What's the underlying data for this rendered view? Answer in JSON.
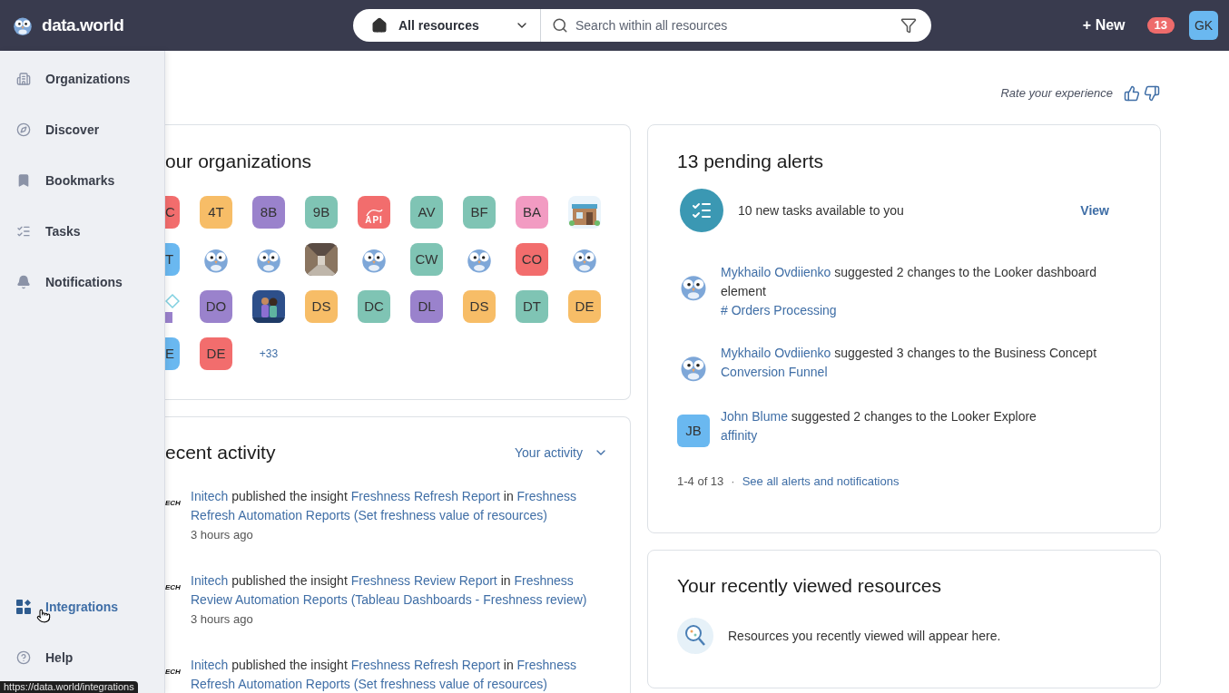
{
  "header": {
    "brand": "data.world",
    "scope": "All resources",
    "search_placeholder": "Search within all resources",
    "new_label": "+ New",
    "notification_count": "13",
    "avatar_initials": "GK"
  },
  "sidebar": {
    "items": [
      {
        "label": "Organizations",
        "hovered": false
      },
      {
        "label": "Discover",
        "hovered": false
      },
      {
        "label": "Bookmarks",
        "hovered": false
      },
      {
        "label": "Tasks",
        "hovered": false
      },
      {
        "label": "Notifications",
        "hovered": false
      }
    ],
    "bottom_items": [
      {
        "label": "Integrations",
        "hovered": true
      },
      {
        "label": "Help",
        "hovered": false
      }
    ]
  },
  "status_url": "https://data.world/integrations",
  "feedback": {
    "label": "Rate your experience"
  },
  "organizations": {
    "title": "our organizations",
    "tiles": [
      {
        "kind": "partial",
        "text": "C",
        "color": "#f26d6d"
      },
      {
        "kind": "initials",
        "text": "4T",
        "color": "#f7bd67"
      },
      {
        "kind": "initials",
        "text": "8B",
        "color": "#9a82cc"
      },
      {
        "kind": "initials",
        "text": "9B",
        "color": "#7fc4b4"
      },
      {
        "kind": "api",
        "text": "API",
        "color": "#f26d6d"
      },
      {
        "kind": "initials",
        "text": "AV",
        "color": "#7fc4b4"
      },
      {
        "kind": "initials",
        "text": "BF",
        "color": "#7fc4b4"
      },
      {
        "kind": "initials",
        "text": "BA",
        "color": "#f29bc2"
      },
      {
        "kind": "picture"
      },
      {
        "kind": "partial",
        "text": "T",
        "color": "#6ab8f0"
      },
      {
        "kind": "owl"
      },
      {
        "kind": "owl"
      },
      {
        "kind": "picture"
      },
      {
        "kind": "owl"
      },
      {
        "kind": "initials",
        "text": "CW",
        "color": "#7fc4b4"
      },
      {
        "kind": "owl"
      },
      {
        "kind": "initials",
        "text": "CO",
        "color": "#f26d6d"
      },
      {
        "kind": "owl"
      },
      {
        "kind": "shapes"
      },
      {
        "kind": "initials",
        "text": "DO",
        "color": "#9a82cc"
      },
      {
        "kind": "picture"
      },
      {
        "kind": "initials",
        "text": "DS",
        "color": "#f7bd67"
      },
      {
        "kind": "initials",
        "text": "DC",
        "color": "#7fc4b4"
      },
      {
        "kind": "initials",
        "text": "DL",
        "color": "#9a82cc"
      },
      {
        "kind": "initials",
        "text": "DS",
        "color": "#f7bd67"
      },
      {
        "kind": "initials",
        "text": "DT",
        "color": "#7fc4b4"
      },
      {
        "kind": "initials",
        "text": "DE",
        "color": "#f7bd67"
      },
      {
        "kind": "partial",
        "text": "E",
        "color": "#6ab8f0"
      },
      {
        "kind": "initials",
        "text": "DE",
        "color": "#f26d6d"
      },
      {
        "kind": "more",
        "text": "+33"
      }
    ]
  },
  "activity": {
    "title": "ecent activity",
    "filter": "Your activity",
    "items": [
      {
        "avatar_text": "ECH",
        "parts": [
          {
            "text": "Initech",
            "link": true
          },
          {
            "text": " published the insight ",
            "link": false
          },
          {
            "text": "Freshness Refresh Report",
            "link": true
          },
          {
            "text": " in ",
            "link": false
          },
          {
            "text": "Freshness",
            "link": true
          },
          {
            "text": "Refresh Automation Reports (Set freshness value of resources)",
            "link": true
          }
        ],
        "time": "3 hours ago"
      },
      {
        "avatar_text": "ECH",
        "parts": [
          {
            "text": "Initech",
            "link": true
          },
          {
            "text": " published the insight ",
            "link": false
          },
          {
            "text": "Freshness Review Report",
            "link": true
          },
          {
            "text": " in ",
            "link": false
          },
          {
            "text": "Freshness",
            "link": true
          },
          {
            "text": "Review Automation Reports (Tableau Dashboards - Freshness review)",
            "link": true
          }
        ],
        "time": "3 hours ago"
      },
      {
        "avatar_text": "ECH",
        "parts": [
          {
            "text": "Initech",
            "link": true
          },
          {
            "text": " published the insight ",
            "link": false
          },
          {
            "text": "Freshness Refresh Report",
            "link": true
          },
          {
            "text": " in ",
            "link": false
          },
          {
            "text": "Freshness",
            "link": true
          },
          {
            "text": "Refresh Automation Reports (Set freshness value of resources)",
            "link": true
          }
        ]
      }
    ]
  },
  "alerts": {
    "title": "13 pending alerts",
    "task": {
      "text": "10 new tasks available to you",
      "action": "View"
    },
    "items": [
      {
        "kind": "owl",
        "parts": [
          {
            "text": "Mykhailo Ovdiienko",
            "link": true
          },
          {
            "text": " suggested 2 changes to the Looker dashboard element",
            "link": false
          }
        ],
        "target": "# Orders Processing"
      },
      {
        "kind": "owl",
        "parts": [
          {
            "text": "Mykhailo Ovdiienko",
            "link": true
          },
          {
            "text": " suggested 3 changes to the Business Concept",
            "link": false
          }
        ],
        "target": "Conversion Funnel"
      },
      {
        "kind": "initials",
        "initials": "JB",
        "color": "#6ab8f0",
        "parts": [
          {
            "text": "John Blume",
            "link": true
          },
          {
            "text": " suggested 2 changes to the Looker Explore",
            "link": false
          }
        ],
        "target": "affinity"
      }
    ],
    "range": "1-4 of 13",
    "separator": "·",
    "see_all": "See all alerts and notifications"
  },
  "recent": {
    "title": "Your recently viewed resources",
    "empty_text": "Resources you recently viewed will appear here."
  }
}
